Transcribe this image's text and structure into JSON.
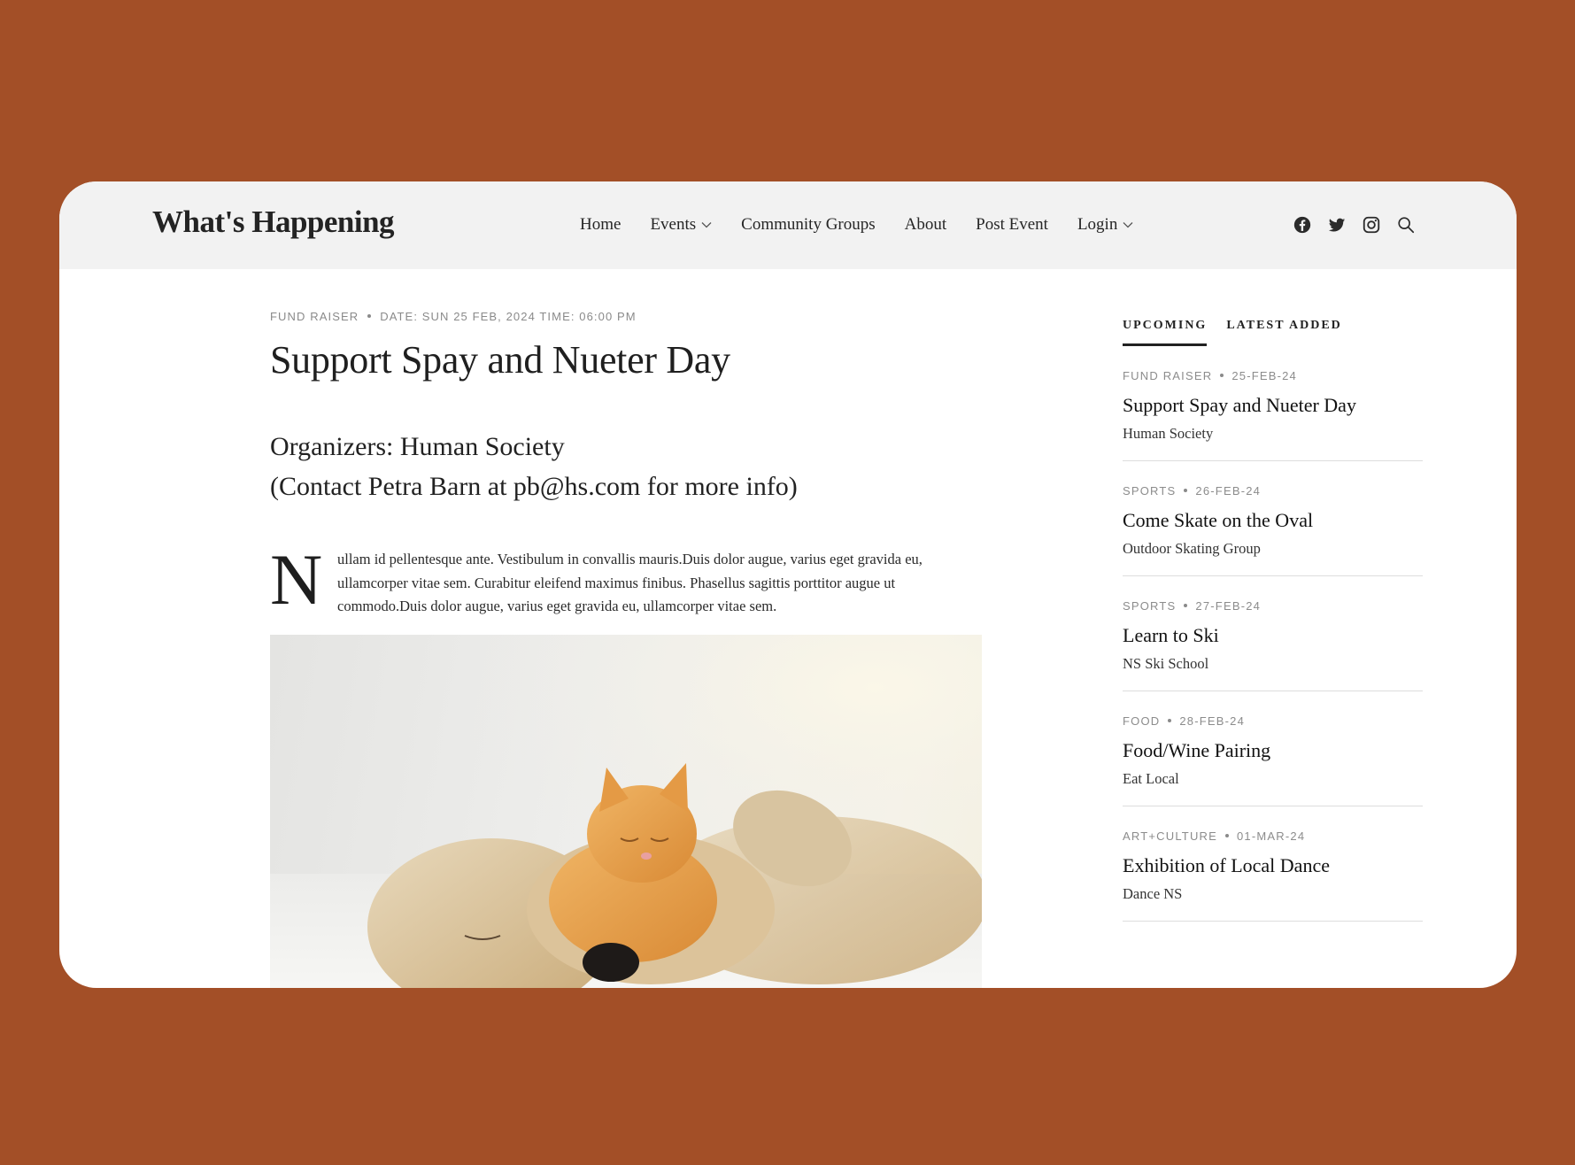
{
  "site": {
    "logo": "What's Happening"
  },
  "nav": {
    "items": [
      {
        "label": "Home",
        "has_dropdown": false
      },
      {
        "label": "Events",
        "has_dropdown": true
      },
      {
        "label": "Community Groups",
        "has_dropdown": false
      },
      {
        "label": "About",
        "has_dropdown": false
      },
      {
        "label": "Post Event",
        "has_dropdown": false
      },
      {
        "label": "Login",
        "has_dropdown": true
      }
    ],
    "icons": [
      "facebook-icon",
      "twitter-icon",
      "instagram-icon",
      "search-icon"
    ]
  },
  "article": {
    "category": "FUND RAISER",
    "datetime": "DATE: SUN 25 FEB, 2024 TIME: 06:00 PM",
    "title": "Support Spay and Nueter Day",
    "organizers_line1": "Organizers: Human Society",
    "organizers_line2": "(Contact Petra Barn at pb@hs.com for more info)",
    "dropcap": "N",
    "body": "ullam id pellentesque ante. Vestibulum in convallis mauris.Duis dolor augue, varius eget gravida eu, ullamcorper vitae sem. Curabitur eleifend maximus finibus. Phasellus sagittis porttitor augue ut commodo.Duis dolor augue, varius eget gravida eu, ullamcorper vitae sem.",
    "image_subject": "golden puppy and orange kitten sleeping on a white rug"
  },
  "sidebar": {
    "tabs": [
      {
        "label": "UPCOMING",
        "active": true
      },
      {
        "label": "LATEST ADDED",
        "active": false
      }
    ],
    "events": [
      {
        "category": "FUND RAISER",
        "date": "25-FEB-24",
        "title": "Support Spay and Nueter Day",
        "organizer": "Human Society"
      },
      {
        "category": "SPORTS",
        "date": "26-FEB-24",
        "title": "Come Skate on the Oval",
        "organizer": "Outdoor Skating Group"
      },
      {
        "category": "SPORTS",
        "date": "27-FEB-24",
        "title": "Learn to Ski",
        "organizer": "NS Ski School"
      },
      {
        "category": "FOOD",
        "date": "28-FEB-24",
        "title": "Food/Wine Pairing",
        "organizer": "Eat Local"
      },
      {
        "category": "ART+CULTURE",
        "date": "01-MAR-24",
        "title": "Exhibition of Local Dance",
        "organizer": "Dance NS"
      }
    ]
  },
  "colors": {
    "background": "#a34f27",
    "header": "#f2f2f2",
    "card": "#ffffff",
    "meta_text": "#8a8a8a"
  }
}
